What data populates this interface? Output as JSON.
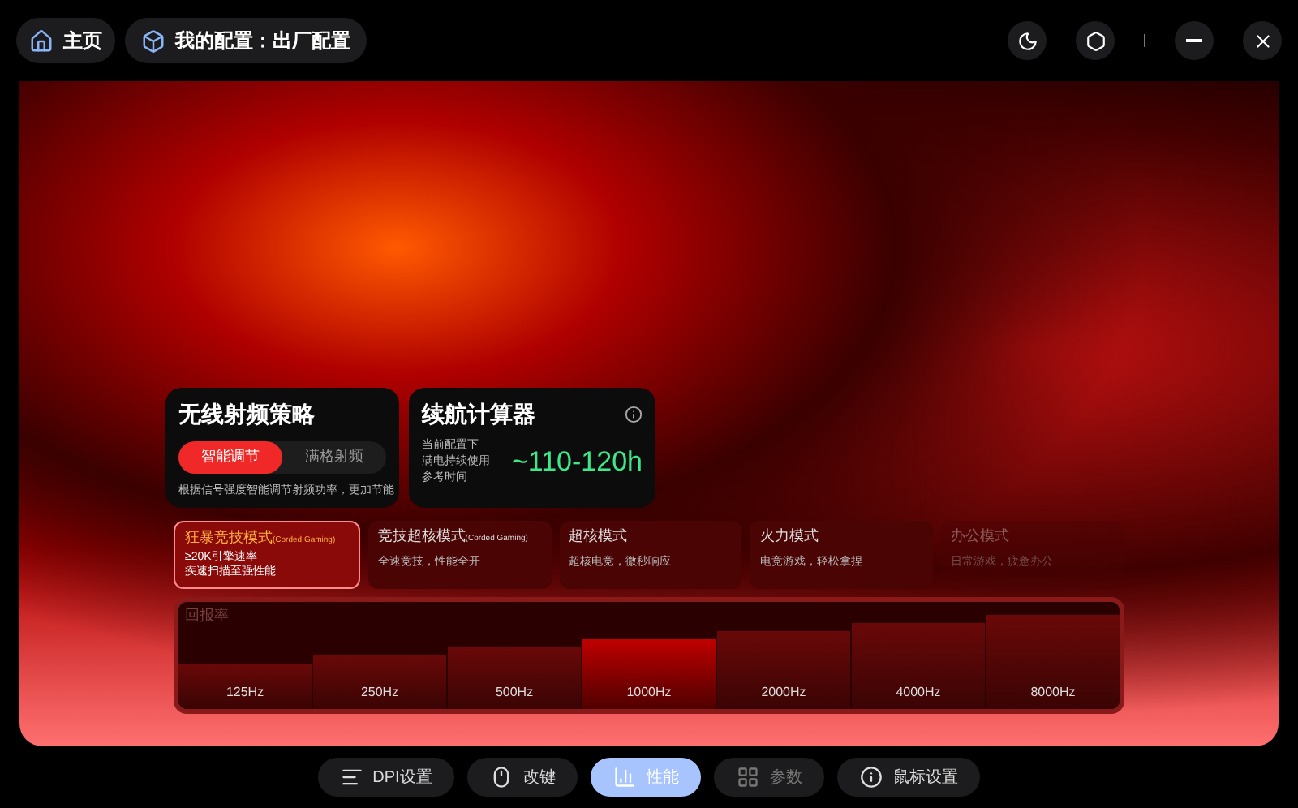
{
  "top_bar": {
    "home": "主页",
    "profile": "我的配置：出厂配置"
  },
  "rf_strategy": {
    "title": "无线射频策略",
    "options": [
      {
        "label": "智能调节",
        "selected": true
      },
      {
        "label": "满格射频",
        "selected": false
      }
    ],
    "description": "根据信号强度智能调节射频功率，更加节能"
  },
  "battery_calculator": {
    "title": "续航计算器",
    "description": [
      "当前配置下",
      "满电持续使用",
      "参考时间"
    ],
    "value": "~110-120h"
  },
  "modes": [
    {
      "title": "狂暴竞技模式",
      "tag": "(Corded Gaming)",
      "lines": [
        "≥20K引擎速率",
        "疾速扫描至强性能"
      ],
      "selected": true,
      "disabled": false
    },
    {
      "title": "竞技超核模式",
      "tag": "(Corded Gaming)",
      "lines": [
        "全速竞技，性能全开"
      ],
      "selected": false,
      "disabled": false
    },
    {
      "title": "超核模式",
      "lines": [
        "超核电竞，微秒响应"
      ],
      "selected": false,
      "disabled": false
    },
    {
      "title": "火力模式",
      "lines": [
        "电竞游戏，轻松拿捏"
      ],
      "selected": false,
      "disabled": false
    },
    {
      "title": "办公模式",
      "lines": [
        "日常游戏，疲惫办公"
      ],
      "selected": false,
      "disabled": true
    }
  ],
  "polling_rate": {
    "label": "回报率",
    "options": [
      {
        "label": "125Hz",
        "selected": false
      },
      {
        "label": "250Hz",
        "selected": false
      },
      {
        "label": "500Hz",
        "selected": false
      },
      {
        "label": "1000Hz",
        "selected": true
      },
      {
        "label": "2000Hz",
        "selected": false
      },
      {
        "label": "4000Hz",
        "selected": false
      },
      {
        "label": "8000Hz",
        "selected": false
      }
    ]
  },
  "bottom_nav": [
    {
      "kind": "dpi",
      "label": "DPI设置",
      "selected": false,
      "disabled": false
    },
    {
      "kind": "keys",
      "label": "改键",
      "selected": false,
      "disabled": false
    },
    {
      "kind": "performance",
      "label": "性能",
      "selected": true,
      "disabled": false
    },
    {
      "kind": "params",
      "label": "参数",
      "selected": false,
      "disabled": true
    },
    {
      "kind": "mouse",
      "label": "鼠标设置",
      "selected": false,
      "disabled": false
    }
  ]
}
